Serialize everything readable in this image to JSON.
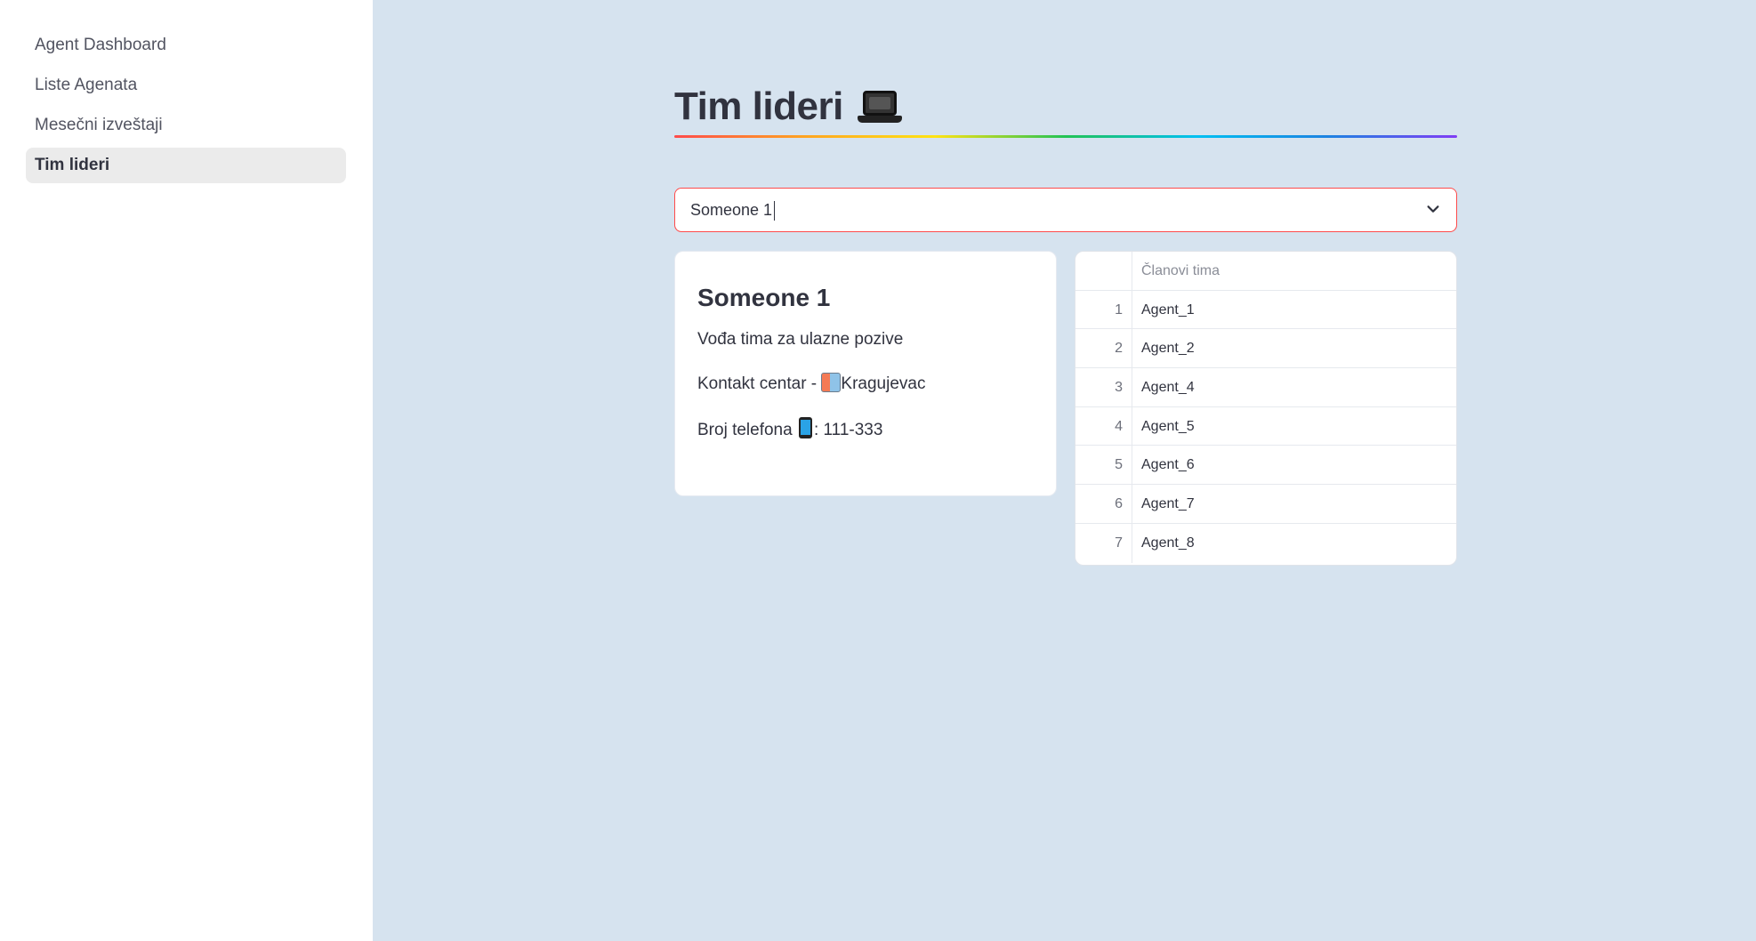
{
  "sidebar": {
    "items": [
      {
        "label": "Agent Dashboard",
        "active": false
      },
      {
        "label": "Liste Agenata",
        "active": false
      },
      {
        "label": "Mesečni izveštaji",
        "active": false
      },
      {
        "label": "Tim lideri",
        "active": true
      }
    ]
  },
  "main": {
    "title": "Tim lideri",
    "title_icon": "laptop-icon",
    "select": {
      "value": "Someone 1"
    },
    "card": {
      "name": "Someone 1",
      "role": "Vođa tima za ulazne pozive",
      "center_prefix": "Kontakt centar - ",
      "center_icon": "office-building-icon",
      "center_city": "Kragujevac",
      "phone_prefix": "Broj telefona",
      "phone_icon": "mobile-phone-icon",
      "phone_value": ": 111-333"
    },
    "table": {
      "header": "Članovi tima",
      "rows": [
        {
          "index": "1",
          "name": "Agent_1"
        },
        {
          "index": "2",
          "name": "Agent_2"
        },
        {
          "index": "3",
          "name": "Agent_4"
        },
        {
          "index": "4",
          "name": "Agent_5"
        },
        {
          "index": "5",
          "name": "Agent_6"
        },
        {
          "index": "6",
          "name": "Agent_7"
        },
        {
          "index": "7",
          "name": "Agent_8"
        }
      ]
    }
  },
  "colors": {
    "sidebar_bg": "#ffffff",
    "main_bg": "#d6e3ef",
    "select_border": "#ff4b4b",
    "active_nav_bg": "#ebebeb"
  }
}
